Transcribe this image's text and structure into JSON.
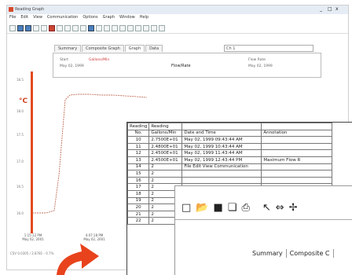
{
  "window": {
    "title": "Reading Graph",
    "controls": [
      "_",
      "□",
      "x"
    ]
  },
  "menubar": [
    "File",
    "Edit",
    "View",
    "Communication",
    "Options",
    "Graph",
    "Window",
    "Help"
  ],
  "tabs": [
    {
      "label": "Summary",
      "active": false
    },
    {
      "label": "Composite Graph",
      "active": false
    },
    {
      "label": "Graph",
      "active": true
    },
    {
      "label": "Data",
      "active": false
    }
  ],
  "channel_select": "Ch 1",
  "legend": {
    "series_name": "Flow/Rate",
    "caption_left_1": "Start",
    "caption_left_2": "May 02, 1999",
    "caption_right_1": "Flow Rate",
    "caption_right_2": "May 02, 1999",
    "caption_red": "Gallons/Min"
  },
  "chart": {
    "unit_symbol": "°C",
    "y_ticks": [
      "16.0",
      "16.5",
      "17.0",
      "17.5",
      "18.0",
      "18.5"
    ],
    "x_ticks": [
      {
        "time": "1:15:12 PM",
        "date": "May 02, 2001"
      },
      {
        "time": "4:07:18 PM",
        "date": "May 02, 2001"
      }
    ],
    "line_color": "#c0705a",
    "axis_color": "#e24a1e"
  },
  "statusbar": "CSV 0.0305 / 2.8781 - 0.7%",
  "table": {
    "header1": [
      "Reading",
      "Reading",
      "",
      ""
    ],
    "header2": [
      "No.",
      "Gallons/Min",
      "Date and Time",
      "Annotation"
    ],
    "rows": [
      [
        "10",
        "2.7500E+01",
        "May 02, 1999 09:43:44 AM",
        ""
      ],
      [
        "11",
        "2.4800E+01",
        "May 02, 1999 10:43:44 AM",
        ""
      ],
      [
        "12",
        "2.4500E+01",
        "May 02, 1999 11:43:44 AM",
        ""
      ],
      [
        "13",
        "2.4500E+01",
        "May 02, 1999 12:43:44 PM",
        "Maximum Flow R"
      ],
      [
        "14",
        "2",
        "File  Edit  View  Communication",
        ""
      ],
      [
        "15",
        "2",
        "",
        ""
      ],
      [
        "16",
        "2",
        "",
        ""
      ],
      [
        "17",
        "2",
        "",
        ""
      ],
      [
        "18",
        "2",
        "",
        ""
      ],
      [
        "19",
        "2",
        "",
        ""
      ],
      [
        "20",
        "2",
        "",
        ""
      ],
      [
        "21",
        "2",
        "",
        ""
      ],
      [
        "22",
        "2",
        "",
        ""
      ]
    ]
  },
  "popup": {
    "menu": [
      "File",
      "Edit",
      "View",
      "Communication"
    ],
    "tabs": [
      "Summary",
      "Composite C"
    ]
  }
}
